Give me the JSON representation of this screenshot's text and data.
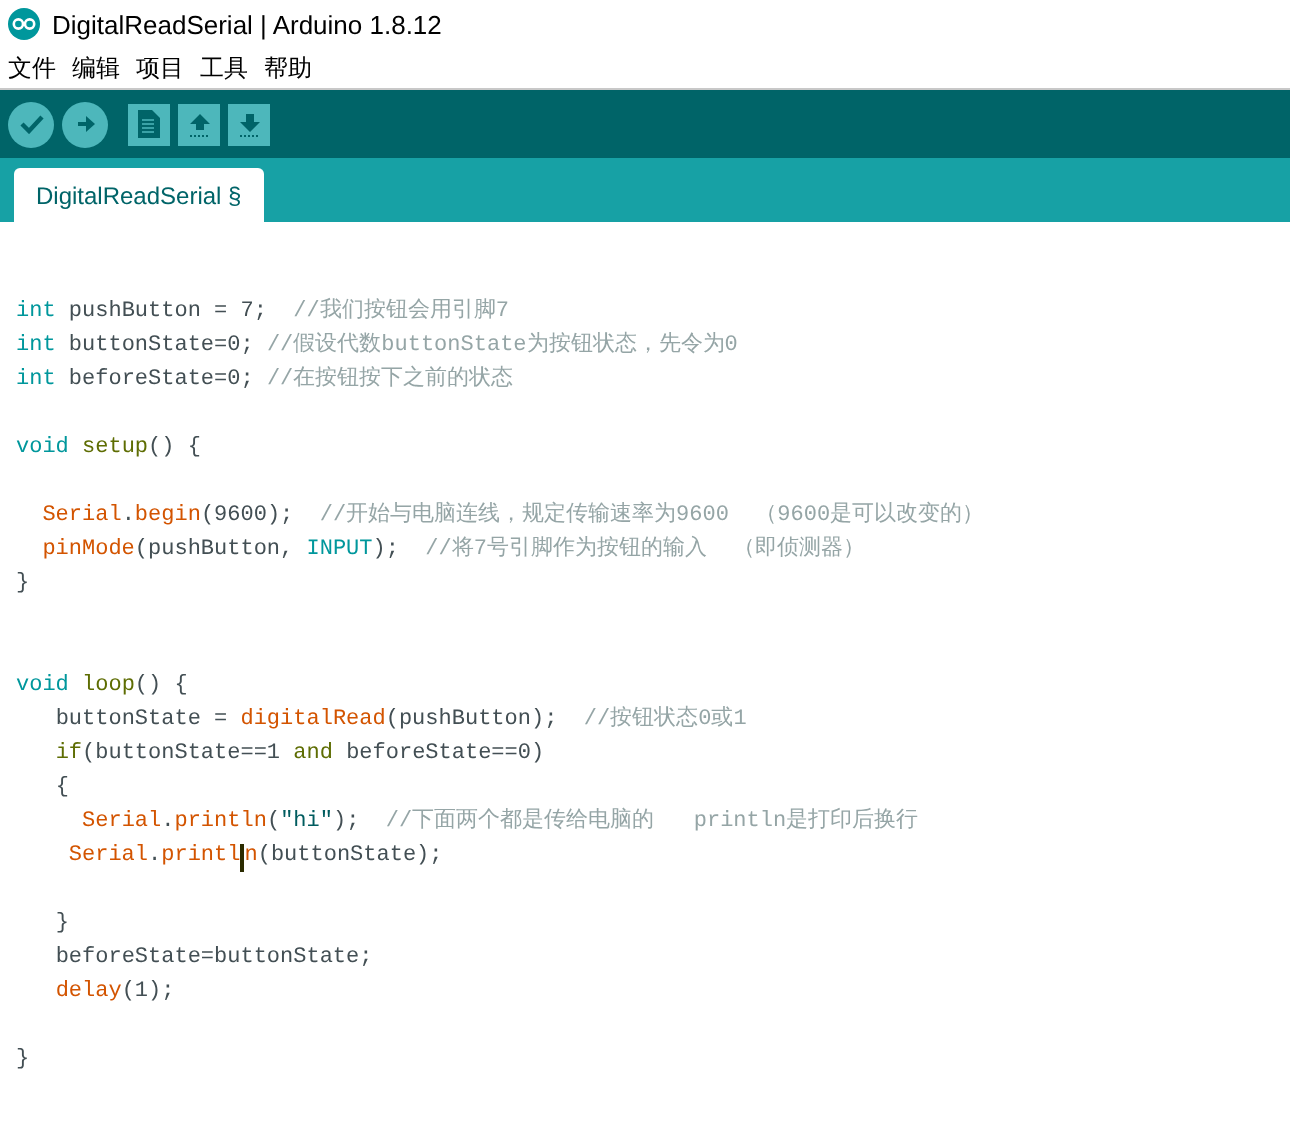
{
  "window": {
    "title": "DigitalReadSerial | Arduino 1.8.12"
  },
  "menu": [
    "文件",
    "编辑",
    "项目",
    "工具",
    "帮助"
  ],
  "tabs": [
    {
      "label": "DigitalReadSerial §",
      "selected": true
    }
  ],
  "code_lines": [
    {
      "kind": "blank"
    },
    {
      "kind": "code",
      "tokens": [
        {
          "kind": "type",
          "text": "int"
        },
        {
          "kind": "plain",
          "text": " pushButton = 7;  "
        },
        {
          "kind": "comment",
          "text": "//我们按钮会用引脚7"
        }
      ]
    },
    {
      "kind": "code",
      "tokens": [
        {
          "kind": "type",
          "text": "int"
        },
        {
          "kind": "plain",
          "text": " buttonState=0; "
        },
        {
          "kind": "comment",
          "text": "//假设代数buttonState为按钮状态，先令为0"
        }
      ]
    },
    {
      "kind": "code",
      "tokens": [
        {
          "kind": "type",
          "text": "int"
        },
        {
          "kind": "plain",
          "text": " beforeState=0; "
        },
        {
          "kind": "comment",
          "text": "//在按钮按下之前的状态"
        }
      ]
    },
    {
      "kind": "blank"
    },
    {
      "kind": "code",
      "tokens": [
        {
          "kind": "type",
          "text": "void"
        },
        {
          "kind": "keyword",
          "text": " setup"
        },
        {
          "kind": "plain",
          "text": "() {"
        }
      ]
    },
    {
      "kind": "blank"
    },
    {
      "kind": "code",
      "tokens": [
        {
          "kind": "function",
          "text": "  Serial"
        },
        {
          "kind": "plain",
          "text": "."
        },
        {
          "kind": "function",
          "text": "begin"
        },
        {
          "kind": "plain",
          "text": "(9600);  "
        },
        {
          "kind": "comment",
          "text": "//开始与电脑连线，规定传输速率为9600  （9600是可以改变的）"
        }
      ]
    },
    {
      "kind": "code",
      "tokens": [
        {
          "kind": "function",
          "text": "  pinMode"
        },
        {
          "kind": "plain",
          "text": "(pushButton, "
        },
        {
          "kind": "type",
          "text": "INPUT"
        },
        {
          "kind": "plain",
          "text": ");  "
        },
        {
          "kind": "comment",
          "text": "//将7号引脚作为按钮的输入  （即侦测器）"
        }
      ]
    },
    {
      "kind": "code",
      "tokens": [
        {
          "kind": "plain",
          "text": "}"
        }
      ]
    },
    {
      "kind": "blank"
    },
    {
      "kind": "blank"
    },
    {
      "kind": "code",
      "tokens": [
        {
          "kind": "type",
          "text": "void"
        },
        {
          "kind": "keyword",
          "text": " loop"
        },
        {
          "kind": "plain",
          "text": "() {"
        }
      ]
    },
    {
      "kind": "code",
      "tokens": [
        {
          "kind": "plain",
          "text": "   buttonState = "
        },
        {
          "kind": "function",
          "text": "digitalRead"
        },
        {
          "kind": "plain",
          "text": "(pushButton);  "
        },
        {
          "kind": "comment",
          "text": "//按钮状态0或1"
        }
      ]
    },
    {
      "kind": "code",
      "tokens": [
        {
          "kind": "keyword",
          "text": "   if"
        },
        {
          "kind": "plain",
          "text": "(buttonState==1 "
        },
        {
          "kind": "keyword",
          "text": "and"
        },
        {
          "kind": "plain",
          "text": " beforeState==0)"
        }
      ]
    },
    {
      "kind": "code",
      "tokens": [
        {
          "kind": "plain",
          "text": "   {"
        }
      ]
    },
    {
      "kind": "code",
      "tokens": [
        {
          "kind": "function",
          "text": "     Serial"
        },
        {
          "kind": "plain",
          "text": "."
        },
        {
          "kind": "function",
          "text": "println"
        },
        {
          "kind": "plain",
          "text": "("
        },
        {
          "kind": "string",
          "text": "\"hi\""
        },
        {
          "kind": "plain",
          "text": ");  "
        },
        {
          "kind": "comment",
          "text": "//下面两个都是传给电脑的   println是打印后换行"
        }
      ]
    },
    {
      "kind": "code",
      "tokens": [
        {
          "kind": "function",
          "text": "    Serial"
        },
        {
          "kind": "plain",
          "text": "."
        },
        {
          "kind": "function",
          "text": "printl"
        },
        {
          "kind": "cursor"
        },
        {
          "kind": "function",
          "text": "n"
        },
        {
          "kind": "plain",
          "text": "(buttonState);"
        }
      ]
    },
    {
      "kind": "blank"
    },
    {
      "kind": "code",
      "tokens": [
        {
          "kind": "plain",
          "text": "   }"
        }
      ]
    },
    {
      "kind": "code",
      "tokens": [
        {
          "kind": "plain",
          "text": "   beforeState=buttonState;"
        }
      ]
    },
    {
      "kind": "code",
      "tokens": [
        {
          "kind": "function",
          "text": "   delay"
        },
        {
          "kind": "plain",
          "text": "(1);"
        }
      ]
    },
    {
      "kind": "blank"
    },
    {
      "kind": "code",
      "tokens": [
        {
          "kind": "plain",
          "text": "}"
        }
      ]
    }
  ]
}
